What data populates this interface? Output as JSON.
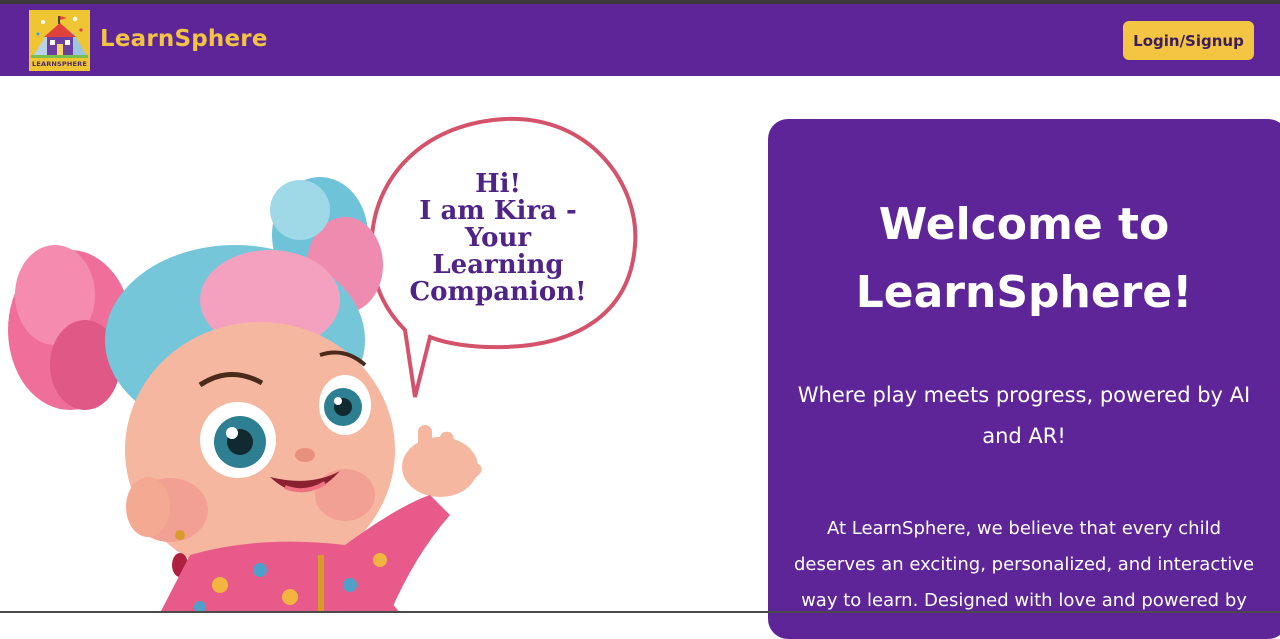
{
  "header": {
    "logo_caption": "LEARNSPHERE",
    "brand": "LearnSphere",
    "login_label": "Login/Signup"
  },
  "hero": {
    "speech": "Hi!\nI am Kira -\nYour\nLearning\nCompanion!"
  },
  "welcome": {
    "title": "Welcome to LearnSphere!",
    "subtitle": "Where play meets progress, powered by AI and AR!",
    "body": "At LearnSphere, we believe that every child deserves an exciting, personalized, and interactive way to learn. Designed with love and powered by"
  },
  "colors": {
    "primary": "#5e2598",
    "accent": "#f4c542",
    "brand_text": "#f2c443",
    "speech_text": "#4f2486"
  },
  "icons": {
    "logo": "school-house-logo-icon",
    "mascot": "kira-mascot-illustration"
  }
}
